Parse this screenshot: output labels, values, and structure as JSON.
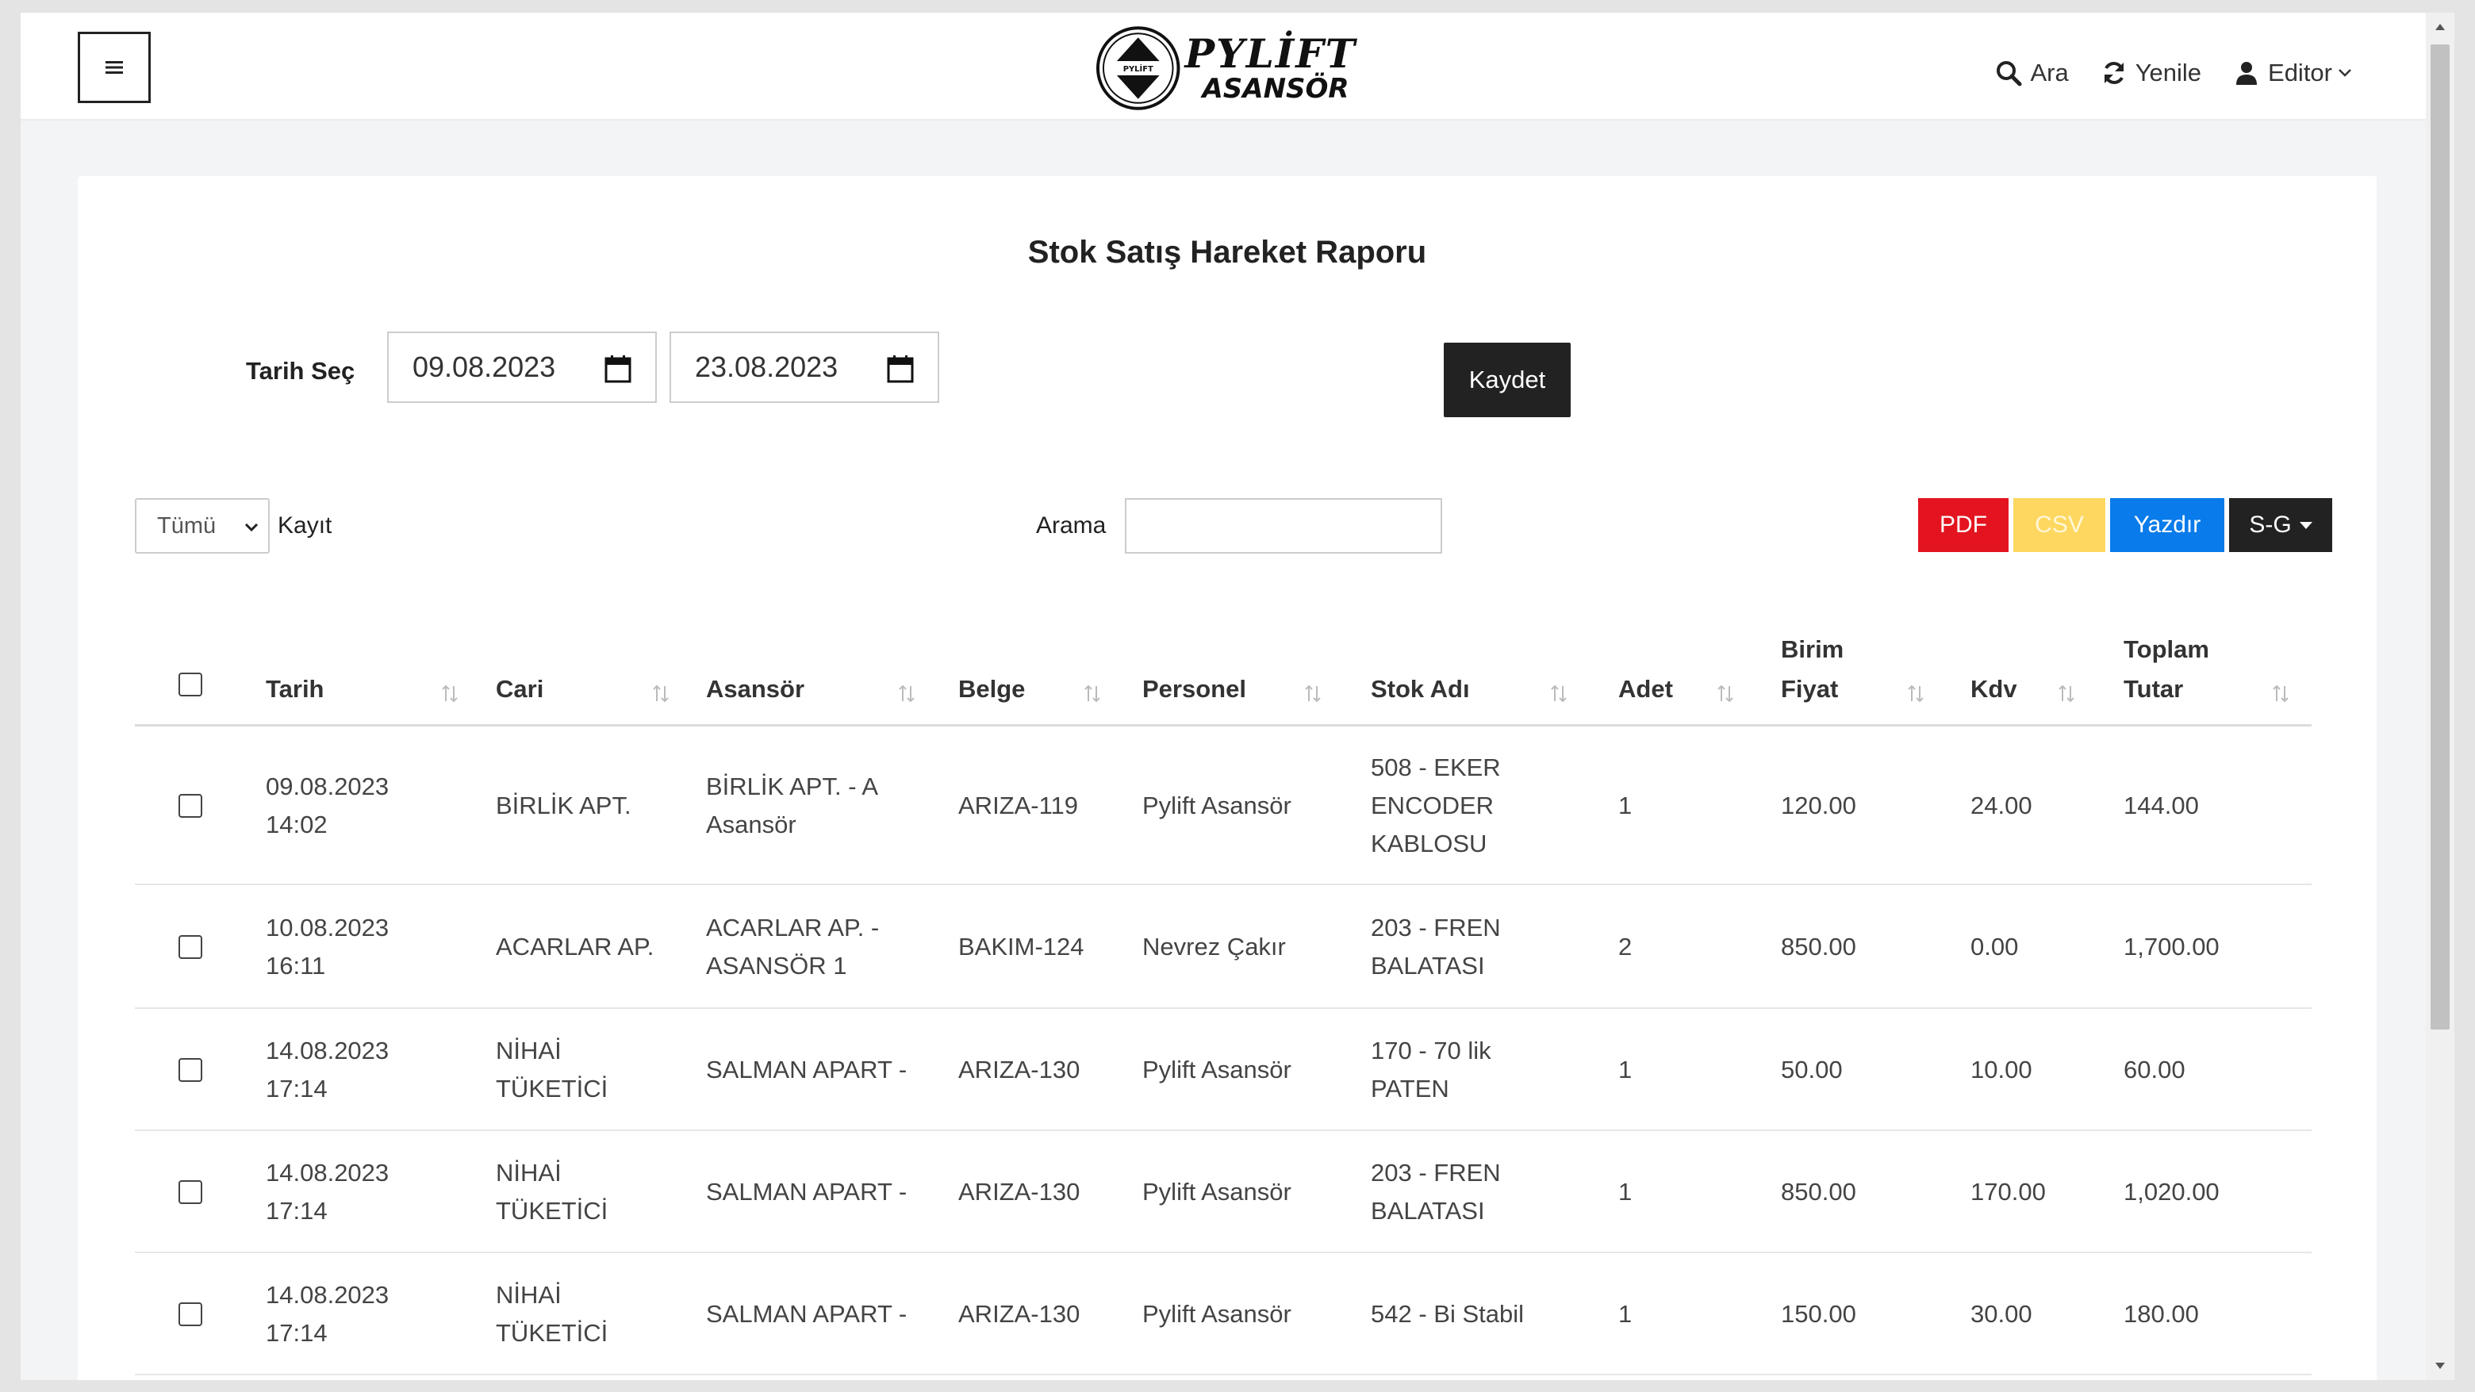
{
  "header": {
    "logo_line1": "PYLİFT",
    "logo_line2": "ASANSÖR",
    "logo_badge": "PYLİFT",
    "search_label": "Ara",
    "refresh_label": "Yenile",
    "user_label": "Editor"
  },
  "report": {
    "title": "Stok Satış Hareket Raporu",
    "date_label": "Tarih Seç",
    "start_date": "09.08.2023",
    "end_date": "23.08.2023",
    "save_label": "Kaydet"
  },
  "controls": {
    "length_value": "Tümü",
    "length_label": "Kayıt",
    "search_label": "Arama",
    "search_value": "",
    "export_pdf": "PDF",
    "export_csv": "CSV",
    "export_print": "Yazdır",
    "export_sg": "S-G"
  },
  "table": {
    "columns": [
      {
        "key": "tarih",
        "lines": [
          "Tarih"
        ]
      },
      {
        "key": "cari",
        "lines": [
          "Cari"
        ]
      },
      {
        "key": "asansor",
        "lines": [
          "Asansör"
        ]
      },
      {
        "key": "belge",
        "lines": [
          "Belge"
        ]
      },
      {
        "key": "personel",
        "lines": [
          "Personel"
        ]
      },
      {
        "key": "stok_adi",
        "lines": [
          "Stok Adı"
        ]
      },
      {
        "key": "adet",
        "lines": [
          "Adet"
        ]
      },
      {
        "key": "birim_fiyat",
        "lines": [
          "Birim",
          "Fiyat"
        ]
      },
      {
        "key": "kdv",
        "lines": [
          "Kdv"
        ]
      },
      {
        "key": "toplam_tutar",
        "lines": [
          "Toplam",
          "Tutar"
        ]
      }
    ],
    "rows": [
      {
        "tarih": "09.08.2023\n14:02",
        "cari": "BİRLİK APT.",
        "asansor": "BİRLİK APT. - A\nAsansör",
        "belge": "ARIZA-119",
        "personel": "Pylift Asansör",
        "stok_adi": "508 - EKER\nENCODER\nKABLOSU",
        "adet": "1",
        "birim_fiyat": "120.00",
        "kdv": "24.00",
        "toplam_tutar": "144.00"
      },
      {
        "tarih": "10.08.2023\n16:11",
        "cari": "ACARLAR AP.",
        "asansor": "ACARLAR AP. -\nASANSÖR 1",
        "belge": "BAKIM-124",
        "personel": "Nevrez Çakır",
        "stok_adi": "203 - FREN\nBALATASI",
        "adet": "2",
        "birim_fiyat": "850.00",
        "kdv": "0.00",
        "toplam_tutar": "1,700.00"
      },
      {
        "tarih": "14.08.2023\n17:14",
        "cari": "NİHAİ\nTÜKETİCİ",
        "asansor": "SALMAN APART -",
        "belge": "ARIZA-130",
        "personel": "Pylift Asansör",
        "stok_adi": "170 - 70 lik\nPATEN",
        "adet": "1",
        "birim_fiyat": "50.00",
        "kdv": "10.00",
        "toplam_tutar": "60.00"
      },
      {
        "tarih": "14.08.2023\n17:14",
        "cari": "NİHAİ\nTÜKETİCİ",
        "asansor": "SALMAN APART -",
        "belge": "ARIZA-130",
        "personel": "Pylift Asansör",
        "stok_adi": "203 - FREN\nBALATASI",
        "adet": "1",
        "birim_fiyat": "850.00",
        "kdv": "170.00",
        "toplam_tutar": "1,020.00"
      },
      {
        "tarih": "14.08.2023\n17:14",
        "cari": "NİHAİ\nTÜKETİCİ",
        "asansor": "SALMAN APART -",
        "belge": "ARIZA-130",
        "personel": "Pylift Asansör",
        "stok_adi": "542 - Bi Stabil",
        "adet": "1",
        "birim_fiyat": "150.00",
        "kdv": "30.00",
        "toplam_tutar": "180.00"
      }
    ]
  },
  "colors": {
    "pdf": "#e3141f",
    "csv": "#fdd760",
    "print": "#0a7bea",
    "dark": "#222222"
  }
}
